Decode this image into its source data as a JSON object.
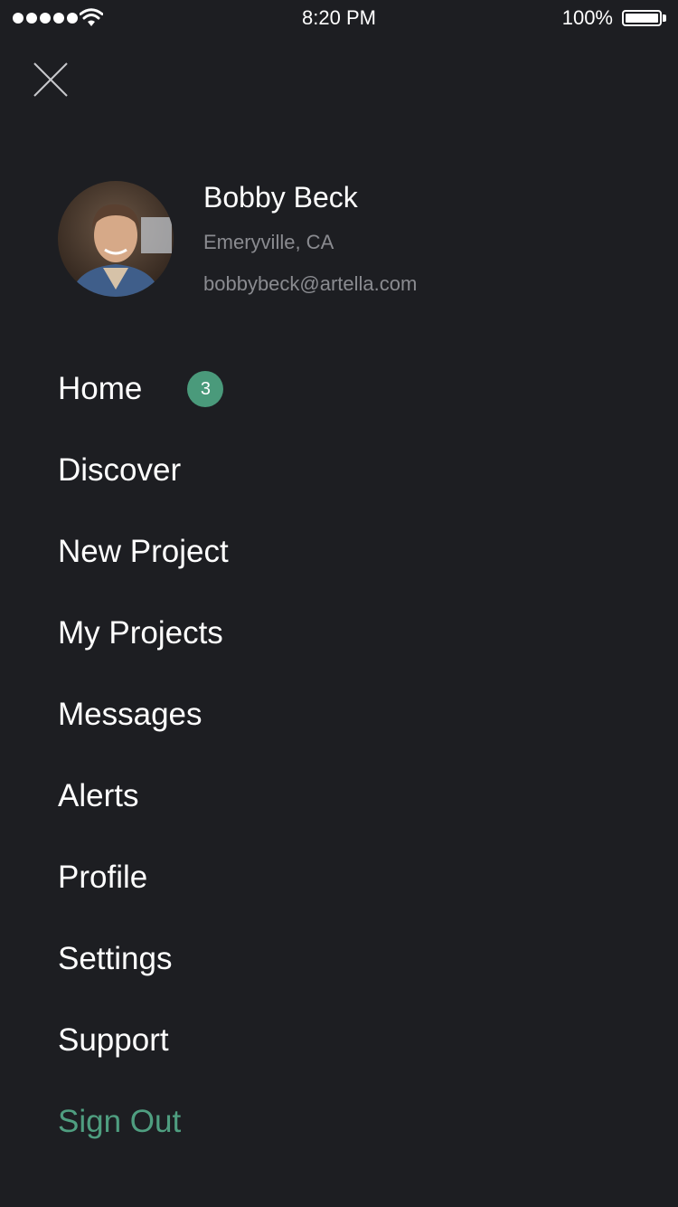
{
  "status_bar": {
    "time": "8:20 PM",
    "battery_percent": "100%",
    "signal_dots": 5,
    "icons": [
      "signal-icon",
      "wifi-icon",
      "battery-icon"
    ]
  },
  "close_icon": "close-icon",
  "profile": {
    "name": "Bobby Beck",
    "location": "Emeryville, CA",
    "email": "bobbybeck@artella.com",
    "avatar_icon": "user-photo"
  },
  "menu": {
    "items": [
      {
        "label": "Home",
        "badge": "3"
      },
      {
        "label": "Discover"
      },
      {
        "label": "New Project"
      },
      {
        "label": "My Projects"
      },
      {
        "label": "Messages"
      },
      {
        "label": "Alerts"
      },
      {
        "label": "Profile"
      },
      {
        "label": "Settings"
      },
      {
        "label": "Support"
      },
      {
        "label": "Sign Out"
      }
    ]
  },
  "colors": {
    "background": "#1d1e22",
    "accent": "#4f9e80",
    "badge": "#4a9a7b",
    "secondary_text": "#8a8b90"
  }
}
